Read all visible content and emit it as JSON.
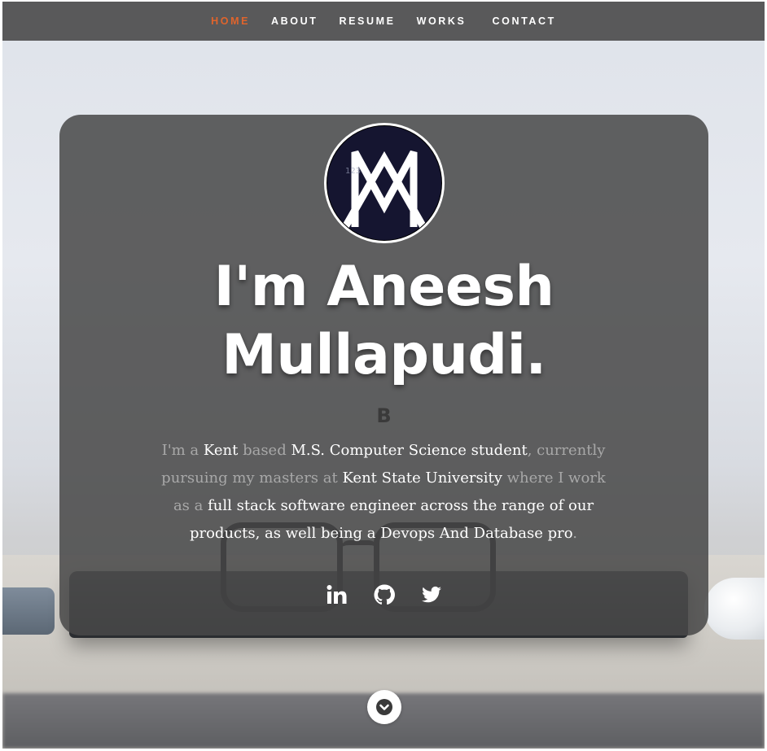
{
  "nav": {
    "items": [
      {
        "label": "HOME",
        "active": true
      },
      {
        "label": "ABOUT",
        "active": false
      },
      {
        "label": "RESUME",
        "active": false
      },
      {
        "label": "WORKS",
        "active": false
      },
      {
        "label": "CONTACT",
        "active": false
      }
    ],
    "active_color": "#e0642c"
  },
  "hero": {
    "headline_line1": "I'm Aneesh",
    "headline_line2": "Mullapudi.",
    "typed_text": "B",
    "bio": {
      "p1": "I'm a ",
      "kent": "Kent",
      "p2": " based ",
      "degree": "M.S. Computer Science student",
      "p3": ", currently pursuing my masters at ",
      "university": "Kent State University",
      "p4": " where I work as a ",
      "role": "full stack software engineer across the range of our products, as well being a Devops And Database pro",
      "p5": "."
    },
    "avatar_icon": "am-monogram-logo"
  },
  "socials": [
    {
      "name": "linkedin-icon"
    },
    {
      "name": "github-icon"
    },
    {
      "name": "twitter-icon"
    }
  ],
  "scroll_icon": "chevron-down-icon"
}
